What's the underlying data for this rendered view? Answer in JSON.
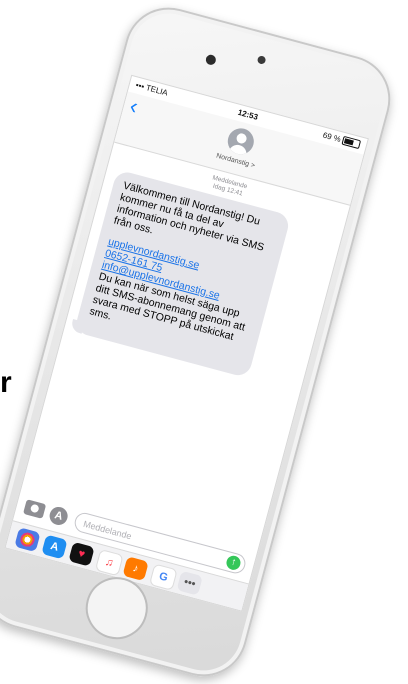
{
  "side_text": "r",
  "status_bar": {
    "carrier": "TELIA",
    "time": "12:53",
    "battery": "69 %"
  },
  "header": {
    "back_icon": "chevron-left-icon",
    "contact_name": "Nordanstig >"
  },
  "thread_meta": {
    "label": "Meddelande",
    "date": "Idag 12:41"
  },
  "message": {
    "intro": "Välkommen till Nordanstig! Du kommer nu få ta del av information och nyheter via SMS från oss.",
    "link_site": "upplevnordanstig.se",
    "link_phone": "0652-161 75",
    "link_email": "info@upplevnordanstig.se",
    "outro": "Du kan när som helst säga upp ditt SMS-abonnemang genom att svara med STOPP på utskickat sms."
  },
  "compose": {
    "placeholder": "Meddelande",
    "send_symbol": "↑"
  },
  "app_tray": {
    "appstore_label": "A",
    "google_label": "G",
    "more_label": "•••",
    "heart_label": "♥",
    "music_label": "♫",
    "guitar_label": "♪"
  }
}
